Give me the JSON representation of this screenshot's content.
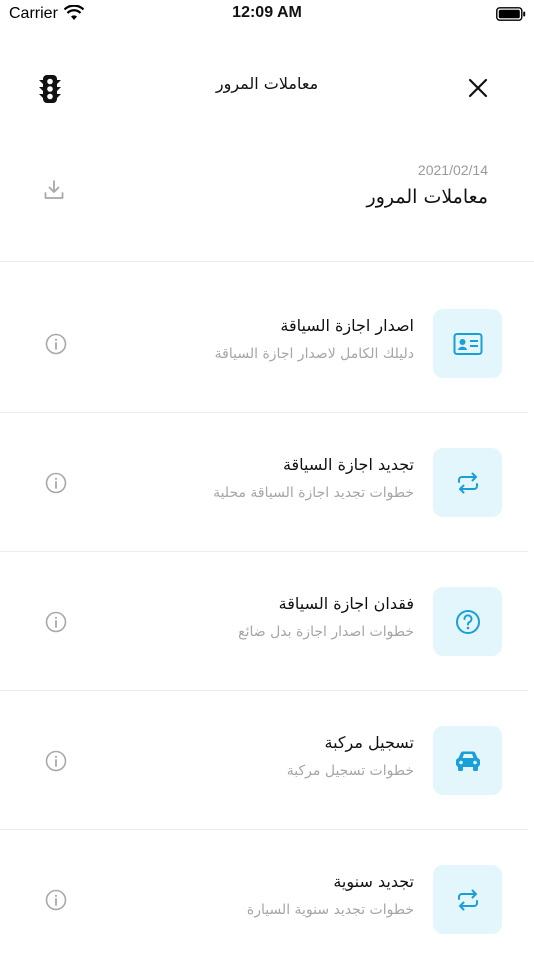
{
  "status_bar": {
    "carrier": "Carrier",
    "time": "12:09 AM"
  },
  "nav": {
    "title": "معاملات المرور"
  },
  "header": {
    "date": "2021/02/14",
    "title": "معاملات المرور"
  },
  "colors": {
    "accent": "#1a9fd6",
    "tile_bg": "#e2f6fb",
    "muted": "#a6a6a6"
  },
  "items": [
    {
      "title": "اصدار اجازة السياقة",
      "subtitle": "دليلك الكامل لاصدار اجازة السياقة",
      "icon": "id-card-icon"
    },
    {
      "title": "تجديد اجازة السياقة",
      "subtitle": "خطوات تجديد اجازة السياقة محلية",
      "icon": "repeat-icon"
    },
    {
      "title": "فقدان اجازة السياقة",
      "subtitle": "خطوات اصدار اجازة بدل ضائع",
      "icon": "question-circle-icon"
    },
    {
      "title": "تسجيل مركبة",
      "subtitle": "خطوات تسجيل مركبة",
      "icon": "car-icon"
    },
    {
      "title": "تجديد سنوية",
      "subtitle": "خطوات تجديد سنوية السيارة",
      "icon": "repeat-icon"
    }
  ]
}
